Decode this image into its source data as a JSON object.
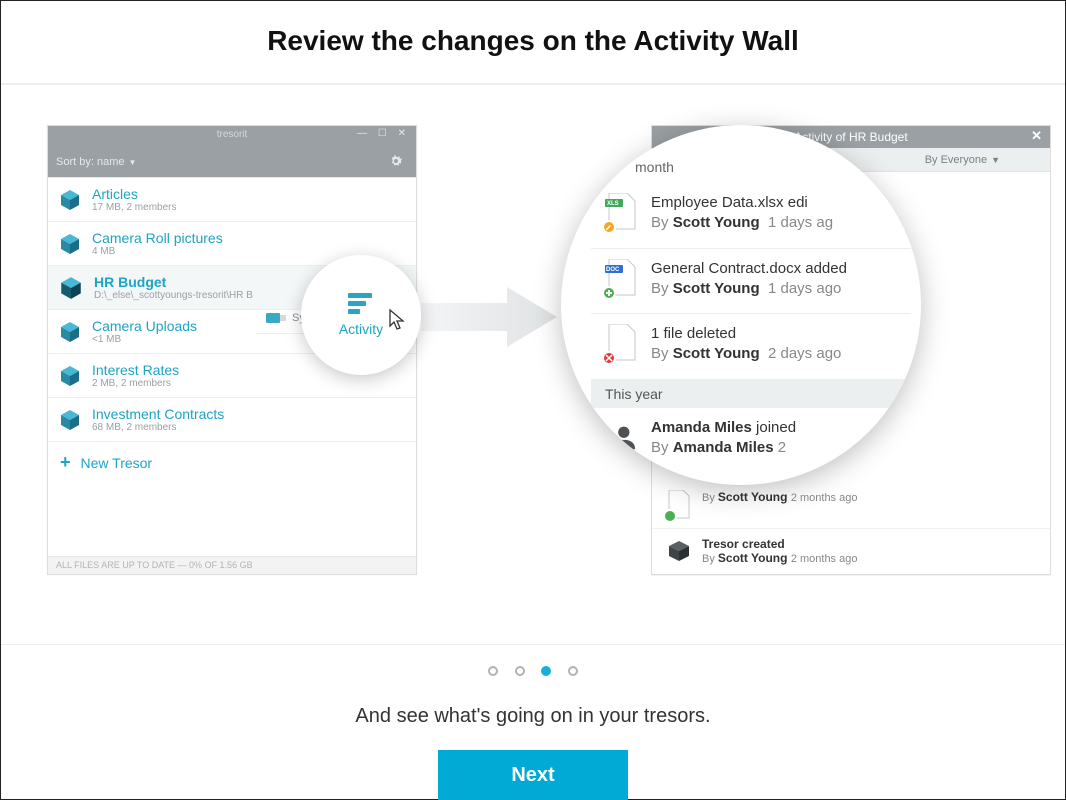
{
  "title": "Review the changes on the Activity Wall",
  "left": {
    "app_name": "tresorit",
    "sort_label": "Sort by: name",
    "items": [
      {
        "name": "Articles",
        "meta": "17 MB, 2 members"
      },
      {
        "name": "Camera Roll pictures",
        "meta": "4 MB"
      },
      {
        "name": "HR Budget",
        "meta": "D:\\_else\\_scottyoungs-tresorit\\HR B",
        "selected": true
      },
      {
        "name": "Camera Uploads",
        "meta": "<1 MB"
      },
      {
        "name": "Interest Rates",
        "meta": "2 MB, 2 members"
      },
      {
        "name": "Investment Contracts",
        "meta": "68 MB, 2 members"
      }
    ],
    "sync_label": "Sync",
    "new_tresor": "New Tresor",
    "status": "ALL FILES ARE UP TO DATE  —  0% OF 1.56 GB"
  },
  "bubble": {
    "label": "Activity"
  },
  "right": {
    "header": "Activity of HR Budget",
    "filter": "By Everyone",
    "sections": {
      "month": "month",
      "year": "This year"
    },
    "big_items": [
      {
        "title_a": "Employee Data.xlsx",
        "title_b": " edi",
        "by": "Scott Young",
        "when": "1 days ag",
        "badge": "edit",
        "ext": "XLS",
        "ext_color": "#3eaa59"
      },
      {
        "title_a": "General Contract.docx",
        "title_b": " added",
        "by": "Scott Young",
        "when": "1 days ago",
        "badge": "add",
        "ext": "DOC",
        "ext_color": "#2e6fd0"
      },
      {
        "title_a": "1 file deleted",
        "title_b": "",
        "by": "Scott Young",
        "when": "2 days ago",
        "badge": "del",
        "ext": "",
        "ext_color": "#c6c9ca"
      },
      {
        "title_a": "Amanda Miles",
        "title_b": " joined",
        "by": "Amanda Miles",
        "when": "2 ",
        "badge": "add",
        "ext": "USER",
        "ext_color": "#555"
      }
    ],
    "small_items": [
      {
        "by": "Scott Young",
        "when": "2 months ago"
      },
      {
        "title": "Tresor created",
        "by": "Scott Young",
        "when": "2 months ago"
      }
    ]
  },
  "pagination": {
    "count": 4,
    "active": 2
  },
  "caption": "And see what's going on in your tresors.",
  "next": "Next"
}
